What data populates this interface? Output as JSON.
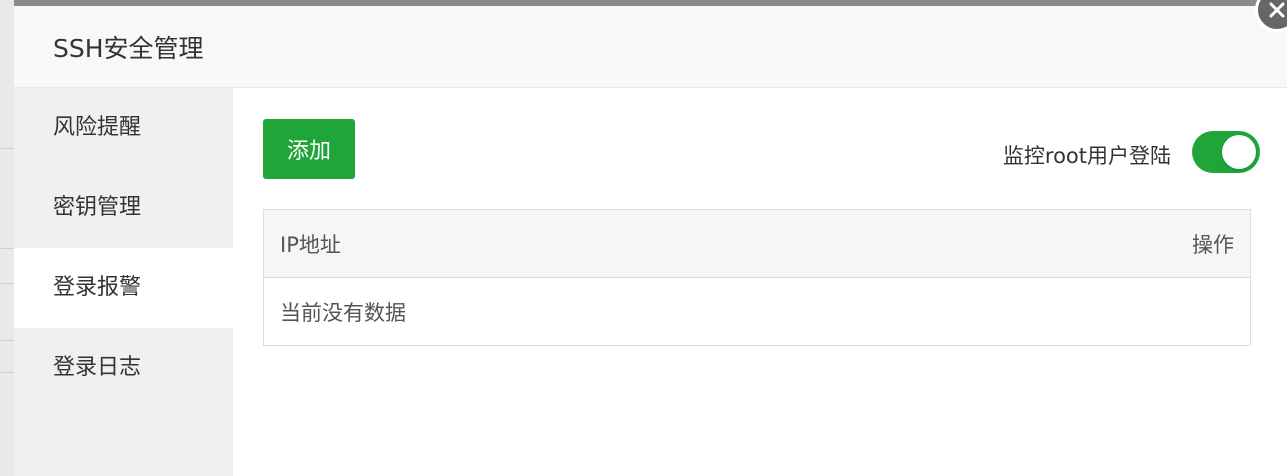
{
  "dialog": {
    "title": "SSH安全管理"
  },
  "sidebar": {
    "items": [
      {
        "label": "风险提醒"
      },
      {
        "label": "密钥管理"
      },
      {
        "label": "登录报警"
      },
      {
        "label": "登录日志"
      }
    ],
    "active_index": 2
  },
  "toolbar": {
    "add_label": "添加",
    "monitor_label": "监控root用户登陆",
    "monitor_enabled": true
  },
  "table": {
    "columns": [
      "IP地址",
      "操作"
    ],
    "empty_text": "当前没有数据"
  },
  "colors": {
    "accent": "#20a53a",
    "title_bg": "#f8f8f8",
    "sidebar_bg": "#f0f0f0"
  },
  "icons": {
    "close": "close-icon"
  }
}
